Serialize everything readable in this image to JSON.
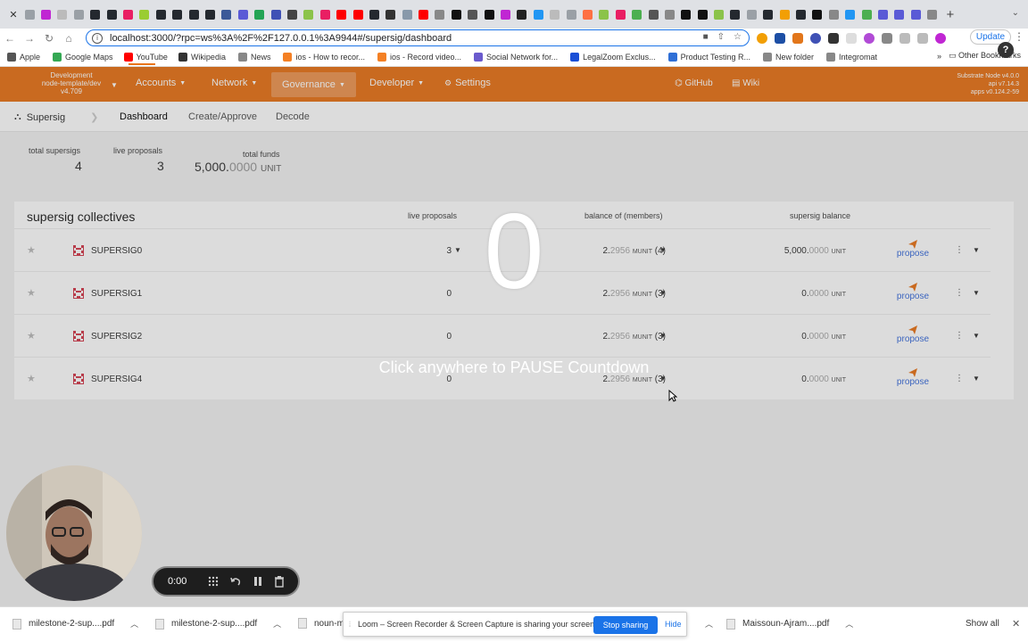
{
  "browser": {
    "url": "localhost:3000/?rpc=ws%3A%2F%2F127.0.0.1%3A9944#/supersig/dashboard",
    "update_label": "Update",
    "bookmarks": [
      {
        "label": "Apple",
        "color": "#555555"
      },
      {
        "label": "Google Maps",
        "color": "#34a853"
      },
      {
        "label": "YouTube",
        "color": "#ff0000"
      },
      {
        "label": "Wikipedia",
        "color": "#333333"
      },
      {
        "label": "News",
        "color": "#888888"
      },
      {
        "label": "ios - How to recor...",
        "color": "#f48024"
      },
      {
        "label": "ios - Record video...",
        "color": "#f48024"
      },
      {
        "label": "Social Network for...",
        "color": "#6a5acd"
      },
      {
        "label": "LegalZoom Exclus...",
        "color": "#1a4fd6"
      },
      {
        "label": "Product Testing R...",
        "color": "#2f6fd6"
      },
      {
        "label": "New folder",
        "color": "#888888"
      },
      {
        "label": "Integromat",
        "color": "#888888"
      }
    ],
    "other_bookmarks": "Other Bookmarks"
  },
  "app": {
    "chain_info": [
      "Development",
      "node-template/dev",
      "v4.709"
    ],
    "menus": [
      "Accounts",
      "Network",
      "Governance",
      "Developer",
      "Settings"
    ],
    "links": [
      "GitHub",
      "Wiki"
    ],
    "node_info": [
      "Substrate Node v4.0.0",
      "api v7.14.3",
      "apps v0.124.2-59"
    ],
    "breadcrumb": "Supersig",
    "subtabs": [
      "Dashboard",
      "Create/Approve",
      "Decode"
    ],
    "summary": {
      "total_supersigs_label": "total supersigs",
      "total_supersigs": "4",
      "live_proposals_label": "live proposals",
      "live_proposals": "3",
      "total_funds_label": "total funds",
      "total_funds_main": "5,000.",
      "total_funds_dim": "0000",
      "total_funds_unit": "UNIT"
    },
    "table": {
      "title": "supersig collectives",
      "headers": {
        "live_proposals": "live proposals",
        "balance_members": "balance of (members)",
        "supersig_balance": "supersig balance"
      },
      "rows": [
        {
          "name": "SUPERSIG0",
          "live": "3",
          "has_caret": true,
          "bal_main": "2.",
          "bal_dim": "2956",
          "bal_unit": "MUNIT",
          "members": "(4)",
          "sbal_main": "5,000.",
          "sbal_dim": "0000",
          "sbal_unit": "UNIT",
          "propose": "propose"
        },
        {
          "name": "SUPERSIG1",
          "live": "0",
          "has_caret": false,
          "bal_main": "2.",
          "bal_dim": "2956",
          "bal_unit": "MUNIT",
          "members": "(3)",
          "sbal_main": "0.",
          "sbal_dim": "0000",
          "sbal_unit": "UNIT",
          "propose": "propose"
        },
        {
          "name": "SUPERSIG2",
          "live": "0",
          "has_caret": false,
          "bal_main": "2.",
          "bal_dim": "2956",
          "bal_unit": "MUNIT",
          "members": "(3)",
          "sbal_main": "0.",
          "sbal_dim": "0000",
          "sbal_unit": "UNIT",
          "propose": "propose"
        },
        {
          "name": "SUPERSIG4",
          "live": "0",
          "has_caret": false,
          "bal_main": "2.",
          "bal_dim": "2956",
          "bal_unit": "MUNIT",
          "members": "(3)",
          "sbal_main": "0.",
          "sbal_dim": "0000",
          "sbal_unit": "UNIT",
          "propose": "propose"
        }
      ]
    }
  },
  "overlay": {
    "countdown": "0",
    "message": "Click anywhere to PAUSE Countdown"
  },
  "recorder": {
    "time": "0:00"
  },
  "shelf": {
    "downloads": [
      "milestone-2-sup....pdf",
      "milestone-2-sup....pdf",
      "noun-m",
      "Maissoun-Ajram....pdf"
    ],
    "show_all": "Show all"
  },
  "share_bar": {
    "message": "Loom – Screen Recorder & Screen Capture is sharing your screen.",
    "stop_label": "Stop sharing",
    "hide_label": "Hide"
  },
  "colors": {
    "accent": "#e8751a",
    "link": "#1a73e8",
    "propose": "#3c6edc"
  }
}
